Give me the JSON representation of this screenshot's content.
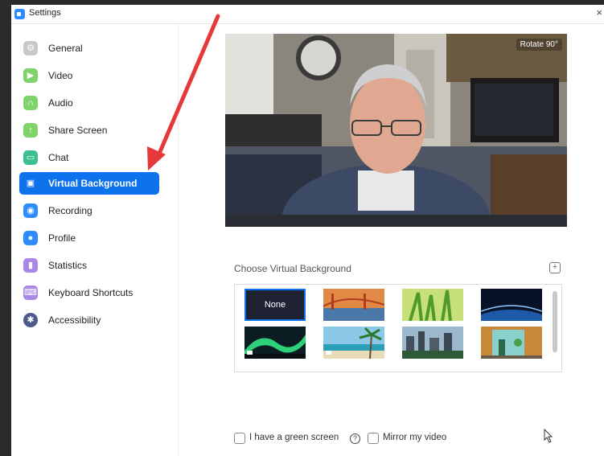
{
  "window": {
    "title": "Settings",
    "close_glyph": "×"
  },
  "sidebar": {
    "items": [
      {
        "label": "General",
        "icon": "gear-icon",
        "color": "#c8c8c8"
      },
      {
        "label": "Video",
        "icon": "camera-icon",
        "color": "#7ed36b"
      },
      {
        "label": "Audio",
        "icon": "headphones-icon",
        "color": "#7ed36b"
      },
      {
        "label": "Share Screen",
        "icon": "share-screen-icon",
        "color": "#7ed36b"
      },
      {
        "label": "Chat",
        "icon": "chat-icon",
        "color": "#3cbf8e"
      },
      {
        "label": "Virtual Background",
        "icon": "person-frame-icon",
        "color": "#0e72ed",
        "active": true
      },
      {
        "label": "Recording",
        "icon": "record-icon",
        "color": "#2d8cff"
      },
      {
        "label": "Profile",
        "icon": "person-icon",
        "color": "#2d8cff"
      },
      {
        "label": "Statistics",
        "icon": "bar-chart-icon",
        "color": "#a887e6"
      },
      {
        "label": "Keyboard Shortcuts",
        "icon": "keyboard-icon",
        "color": "#a887e6"
      },
      {
        "label": "Accessibility",
        "icon": "accessibility-icon",
        "color": "#4e5a8a"
      }
    ]
  },
  "preview": {
    "rotate_label": "Rotate 90°"
  },
  "virtual_background": {
    "section_label": "Choose Virtual Background",
    "thumbnails": [
      {
        "name": "None"
      },
      {
        "name": "golden-gate-bridge"
      },
      {
        "name": "grass"
      },
      {
        "name": "earth-from-space"
      },
      {
        "name": "aurora"
      },
      {
        "name": "beach-palm"
      },
      {
        "name": "city-skyline"
      },
      {
        "name": "office-interior"
      }
    ]
  },
  "options": {
    "green_screen_label": "I have a green screen",
    "mirror_label": "Mirror my video",
    "help_glyph": "?"
  },
  "colors": {
    "accent": "#0e72ed",
    "annotation_arrow": "#e5383b"
  }
}
